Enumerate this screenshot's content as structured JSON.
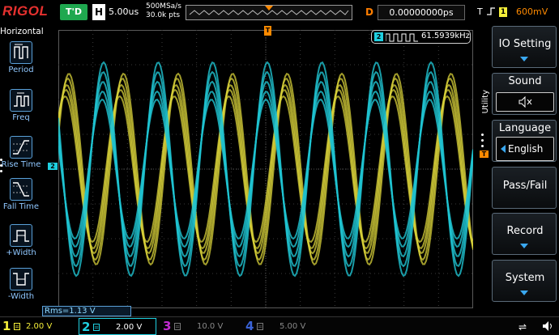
{
  "topbar": {
    "logo": "RIGOL",
    "trigger_status": "T'D",
    "horizontal_badge": "H",
    "timebase": "5.00us",
    "sample_rate": "500MSa/s",
    "memory_depth": "30.0k pts",
    "delay_badge": "D",
    "delay_value": "0.00000000ps",
    "trigger_badge": "T",
    "trigger_source": "1",
    "trigger_level": "600mV"
  },
  "left_panel": {
    "title": "Horizontal",
    "items": [
      {
        "label": "Period",
        "icon": "period-icon"
      },
      {
        "label": "Freq",
        "icon": "freq-icon"
      },
      {
        "label": "Rise Time",
        "icon": "rise-time-icon"
      },
      {
        "label": "Fall Time",
        "icon": "fall-time-icon"
      },
      {
        "label": "+Width",
        "icon": "pos-width-icon"
      },
      {
        "label": "-Width",
        "icon": "neg-width-icon"
      }
    ]
  },
  "counter": {
    "channel": "2",
    "value": "61.5939kHz"
  },
  "markers": {
    "ch2": "2",
    "trigger_pos": "T",
    "trigger_level": "T"
  },
  "measurement": {
    "rms": "Rms=1.13 V"
  },
  "right_panel": {
    "menu_title": "Utility",
    "buttons": [
      {
        "label": "IO Setting"
      },
      {
        "label": "Sound",
        "sub": "◁×"
      },
      {
        "label": "Language",
        "sub": "English"
      },
      {
        "label": "Pass/Fail"
      },
      {
        "label": "Record"
      },
      {
        "label": "System"
      }
    ]
  },
  "bottom_bar": {
    "channels": [
      {
        "num": "1",
        "scale": "2.00 V",
        "color": "#f5ef3a"
      },
      {
        "num": "2",
        "scale": "2.00 V",
        "color": "#1fcfe0"
      },
      {
        "num": "3",
        "scale": "10.0 V",
        "color": "#c22bd1"
      },
      {
        "num": "4",
        "scale": "5.00 V",
        "color": "#3a63d8"
      }
    ]
  },
  "colors": {
    "ch1": "#d8d23a",
    "ch2": "#1fc4d2",
    "trigger": "#ff8a00",
    "accent": "#3aa8f0"
  }
}
